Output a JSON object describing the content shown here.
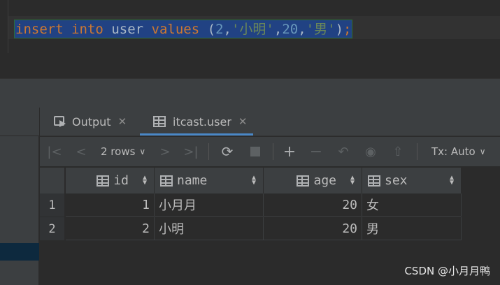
{
  "editor": {
    "code": {
      "kw_insert": "insert",
      "kw_into": "into",
      "table": "user",
      "kw_values": "values",
      "open_paren": "(",
      "v1": "2",
      "comma1": ",",
      "v2": "'小明'",
      "comma2": ",",
      "v3": "20",
      "comma3": ",",
      "v4": "'男'",
      "close_paren": ")",
      "semicolon": ";"
    }
  },
  "tabs": [
    {
      "label": "Output",
      "icon": "output-icon",
      "active": false
    },
    {
      "label": "itcast.user",
      "icon": "table-icon",
      "active": true
    }
  ],
  "toolbar": {
    "rows_label": "2 rows",
    "tx_label": "Tx: Auto",
    "icons": [
      "first-page-icon",
      "prev-page-icon",
      "next-page-icon",
      "last-page-icon",
      "refresh-icon",
      "stop-icon",
      "add-row-icon",
      "delete-row-icon",
      "revert-icon",
      "preview-changes-icon",
      "submit-icon"
    ]
  },
  "grid": {
    "columns": [
      "id",
      "name",
      "age",
      "sex"
    ],
    "rows": [
      {
        "num": "1",
        "id": "1",
        "name": "小月月",
        "age": "20",
        "sex": "女"
      },
      {
        "num": "2",
        "id": "2",
        "name": "小明",
        "age": "20",
        "sex": "男"
      }
    ]
  },
  "watermark": "CSDN @小月月鸭",
  "colors": {
    "background": "#2b2b2b",
    "panel": "#3c3f41",
    "selection": "#214283",
    "keyword": "#cc7832",
    "number": "#6897bb",
    "string": "#6a8759",
    "tab_underline": "#4a88c7"
  }
}
